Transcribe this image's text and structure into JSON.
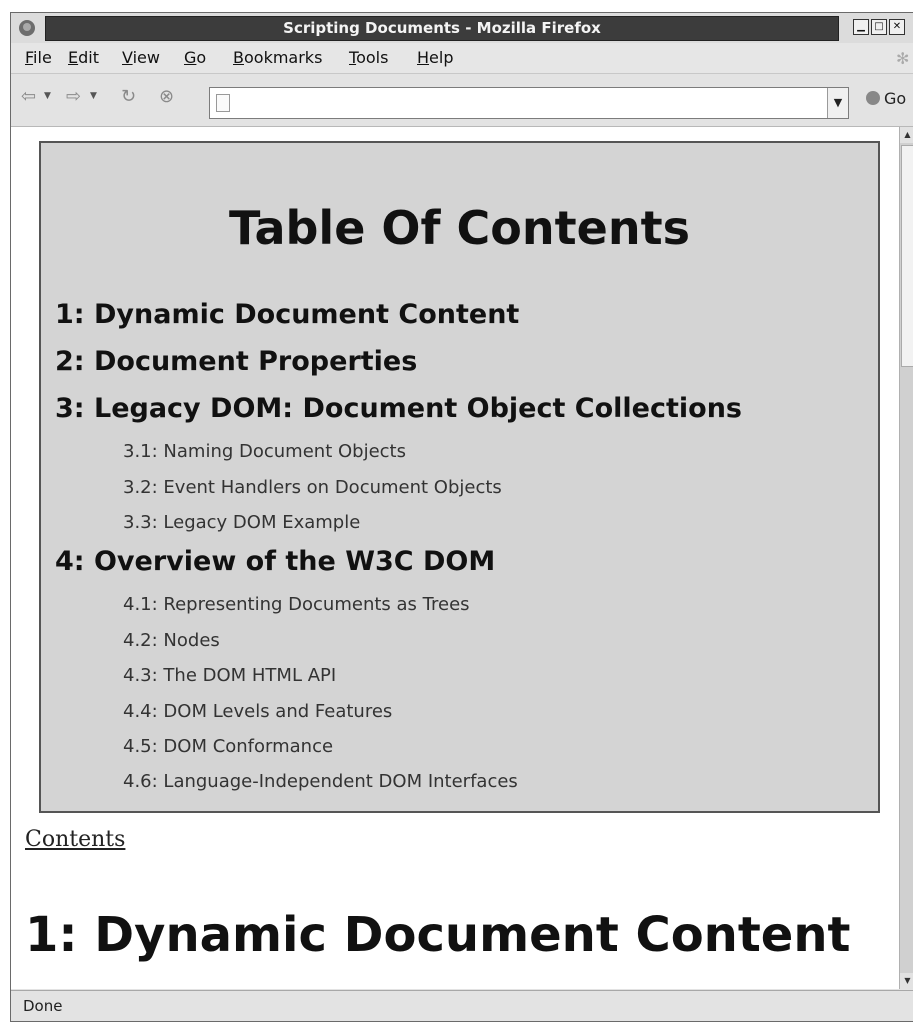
{
  "window": {
    "title": "Scripting Documents - Mozilla Firefox"
  },
  "menu": {
    "file": "File",
    "edit": "Edit",
    "view": "View",
    "go": "Go",
    "bookmarks": "Bookmarks",
    "tools": "Tools",
    "help": "Help"
  },
  "toolbar": {
    "url": "",
    "go_label": "Go"
  },
  "content": {
    "toc_title": "Table Of Contents",
    "sections": [
      {
        "label": "1: Dynamic Document Content"
      },
      {
        "label": "2: Document Properties"
      },
      {
        "label": "3: Legacy DOM: Document Object Collections",
        "subsections": [
          "3.1: Naming Document Objects",
          "3.2: Event Handlers on Document Objects",
          "3.3: Legacy DOM Example"
        ]
      },
      {
        "label": "4: Overview of the W3C DOM",
        "subsections": [
          "4.1: Representing Documents as Trees",
          "4.2: Nodes",
          "4.3: The DOM HTML API",
          "4.4: DOM Levels and Features",
          "4.5: DOM Conformance",
          "4.6: Language-Independent DOM Interfaces"
        ]
      }
    ],
    "contents_link": "Contents",
    "section_heading": "1: Dynamic Document Content"
  },
  "status": {
    "text": "Done"
  }
}
